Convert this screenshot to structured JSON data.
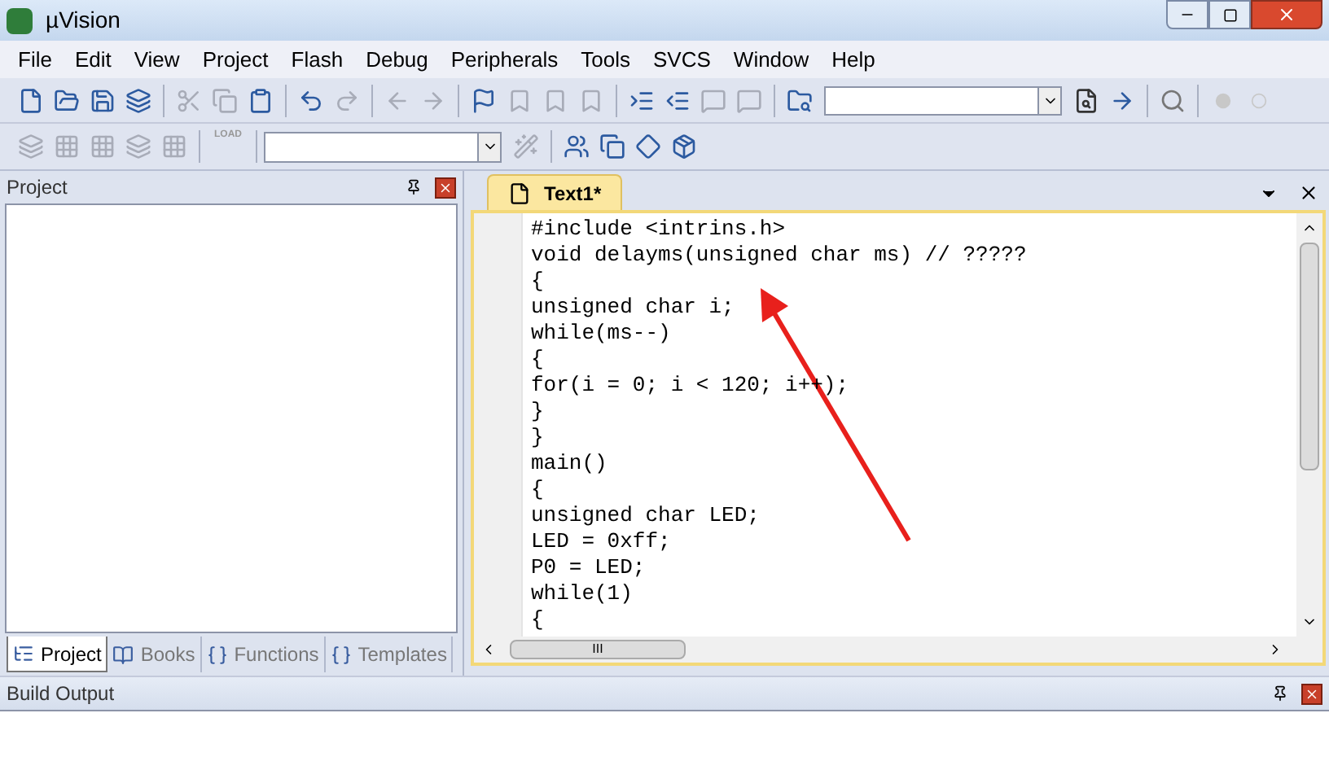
{
  "window": {
    "title": "µVision"
  },
  "menu": [
    "File",
    "Edit",
    "View",
    "Project",
    "Flash",
    "Debug",
    "Peripherals",
    "Tools",
    "SVCS",
    "Window",
    "Help"
  ],
  "toolbar_1": [
    {
      "disabled": false
    },
    {
      "disabled": false
    },
    {
      "disabled": false
    },
    {
      "disabled": false
    },
    {
      "disabled": true
    },
    {
      "disabled": true
    },
    {
      "disabled": false
    },
    {
      "disabled": false
    },
    {
      "disabled": true
    },
    {
      "disabled": true
    },
    {
      "disabled": true
    },
    {
      "disabled": false
    },
    {
      "disabled": true
    },
    {
      "disabled": true
    },
    {
      "disabled": true
    },
    {
      "disabled": false
    },
    {
      "disabled": false
    },
    {
      "disabled": true
    },
    {
      "disabled": true
    },
    {
      "disabled": false
    }
  ],
  "toolbar_2": [
    {
      "disabled": true
    },
    {
      "disabled": true
    },
    {
      "disabled": true
    },
    {
      "disabled": true
    },
    {
      "disabled": true
    },
    {
      "disabled": true
    },
    {
      "disabled": true
    },
    {
      "disabled": false
    },
    {
      "disabled": false
    },
    {
      "disabled": false
    },
    {
      "disabled": false
    }
  ],
  "load_label": "LOAD",
  "project_panel": {
    "title": "Project",
    "tabs": [
      {
        "label": "Project",
        "selected": true
      },
      {
        "label": "Books",
        "selected": false
      },
      {
        "label": "Functions",
        "selected": false
      },
      {
        "label": "Templates",
        "selected": false
      }
    ]
  },
  "editor": {
    "tab": "Text1*",
    "lines": [
      "#include <intrins.h>",
      "void delayms(unsigned char ms) // ?????",
      "{",
      "unsigned char i;",
      "while(ms--)",
      "{",
      "for(i = 0; i < 120; i++);",
      "}",
      "}",
      "main()",
      "{",
      "unsigned char LED;",
      "LED = 0xff;",
      "P0 = LED;",
      "while(1)",
      "{"
    ]
  },
  "scroll_grip": "III",
  "build_output": {
    "title": "Build Output"
  }
}
